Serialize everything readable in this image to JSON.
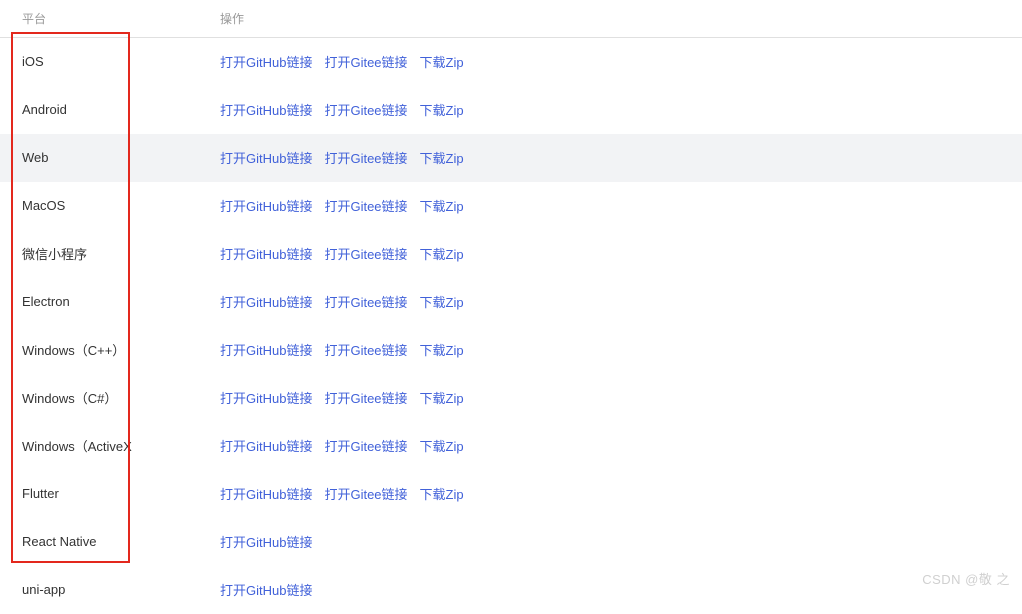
{
  "header": {
    "platform": "平台",
    "action": "操作"
  },
  "actions": {
    "github": "打开GitHub链接",
    "gitee": "打开Gitee链接",
    "zip": "下载Zip"
  },
  "rows": [
    {
      "platform": "iOS",
      "links": [
        "github",
        "gitee",
        "zip"
      ],
      "hovered": false
    },
    {
      "platform": "Android",
      "links": [
        "github",
        "gitee",
        "zip"
      ],
      "hovered": false
    },
    {
      "platform": "Web",
      "links": [
        "github",
        "gitee",
        "zip"
      ],
      "hovered": true
    },
    {
      "platform": "MacOS",
      "links": [
        "github",
        "gitee",
        "zip"
      ],
      "hovered": false
    },
    {
      "platform": "微信小程序",
      "links": [
        "github",
        "gitee",
        "zip"
      ],
      "hovered": false
    },
    {
      "platform": "Electron",
      "links": [
        "github",
        "gitee",
        "zip"
      ],
      "hovered": false
    },
    {
      "platform": "Windows（C++）",
      "links": [
        "github",
        "gitee",
        "zip"
      ],
      "hovered": false
    },
    {
      "platform": "Windows（C#）",
      "links": [
        "github",
        "gitee",
        "zip"
      ],
      "hovered": false
    },
    {
      "platform": "Windows（ActiveX",
      "links": [
        "github",
        "gitee",
        "zip"
      ],
      "hovered": false
    },
    {
      "platform": "Flutter",
      "links": [
        "github",
        "gitee",
        "zip"
      ],
      "hovered": false
    },
    {
      "platform": "React Native",
      "links": [
        "github"
      ],
      "hovered": false
    },
    {
      "platform": "uni-app",
      "links": [
        "github"
      ],
      "hovered": false
    }
  ],
  "watermark": "CSDN @敬 之"
}
